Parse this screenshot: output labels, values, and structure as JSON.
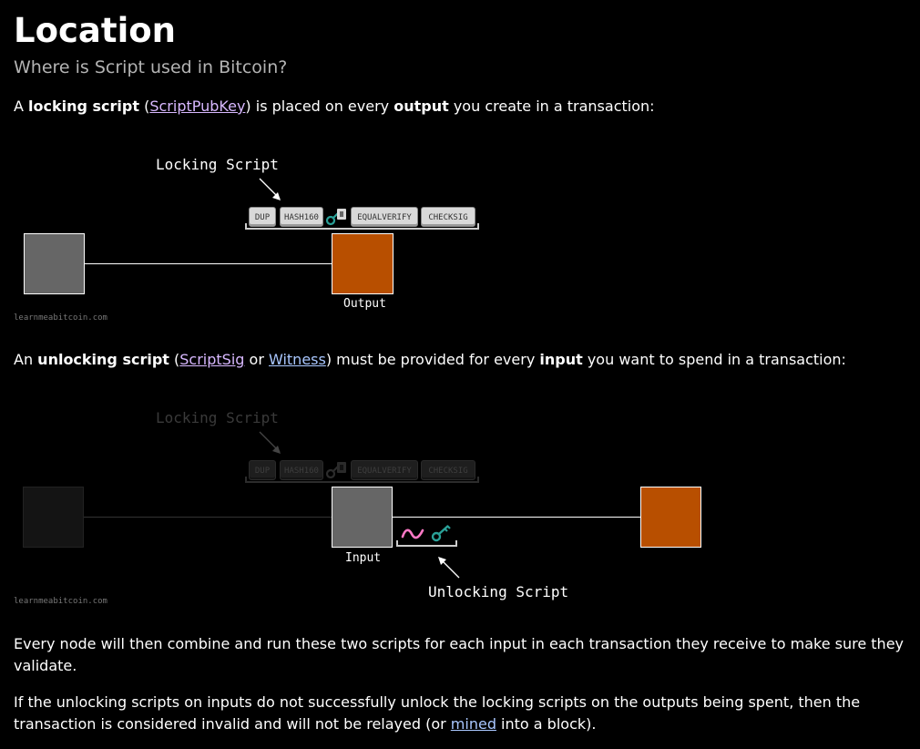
{
  "header": {
    "title": "Location",
    "subtitle": "Where is Script used in Bitcoin?"
  },
  "para1": {
    "t1": "A ",
    "b1": "locking script",
    "t2": " (",
    "link": "ScriptPubKey",
    "t3": ") is placed on every ",
    "b2": "output",
    "t4": " you create in a transaction:"
  },
  "diagram1": {
    "locking_label": "Locking Script",
    "ops": [
      "DUP",
      "HASH160",
      "EQUALVERIFY",
      "CHECKSIG"
    ],
    "output_label": "Output",
    "watermark": "learnmeabitcoin.com"
  },
  "para2": {
    "t1": "An ",
    "b1": "unlocking script",
    "t2": " (",
    "link1": "ScriptSig",
    "t3": " or ",
    "link2": "Witness",
    "t4": ") must be provided for every ",
    "b2": "input",
    "t5": " you want to spend in a transaction:"
  },
  "diagram2": {
    "locking_label": "Locking Script",
    "ops": [
      "DUP",
      "HASH160",
      "EQUALVERIFY",
      "CHECKSIG"
    ],
    "input_label": "Input",
    "unlocking_label": "Unlocking Script",
    "watermark": "learnmeabitcoin.com"
  },
  "para3": {
    "text": "Every node will then combine and run these two scripts for each input in each transaction they receive to make sure they validate."
  },
  "para4": {
    "t1": "If the unlocking scripts on inputs do not successfully unlock the locking scripts on the outputs being spent, then the transaction is considered invalid and will not be relayed (or ",
    "link": "mined",
    "t2": " into a block)."
  },
  "colors": {
    "background": "#000000",
    "output_box": "#b84f00",
    "input_box": "#666666",
    "key": "#2aa198",
    "signature": "#ff79c6"
  },
  "icons": [
    "key-icon",
    "signature-icon",
    "arrow-icon"
  ]
}
